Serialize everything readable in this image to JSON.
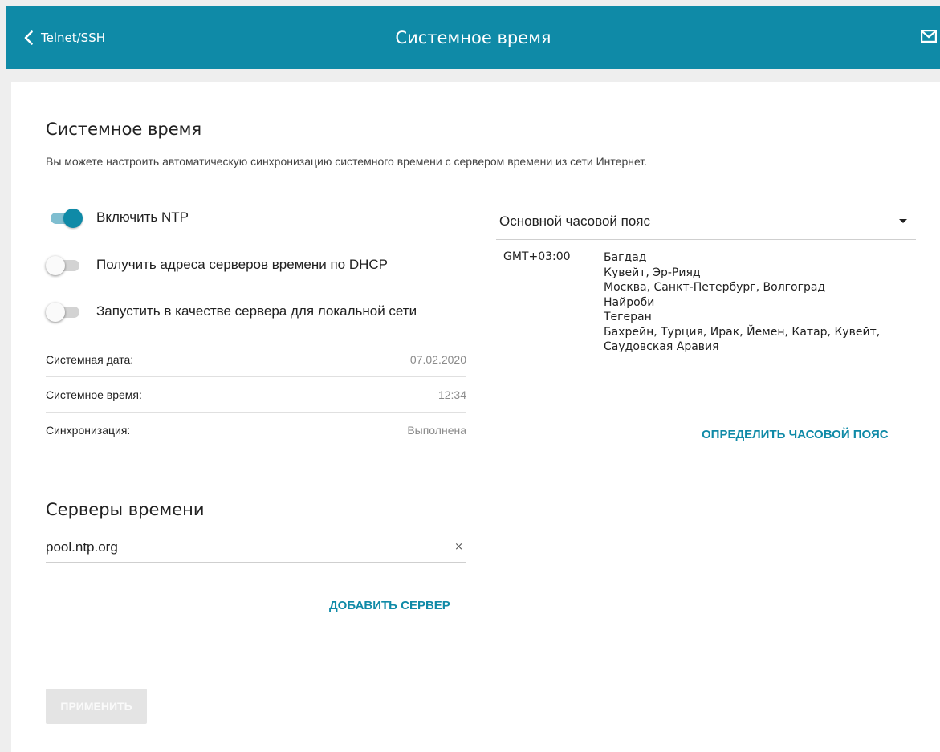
{
  "topbar": {
    "back_label": "Telnet/SSH",
    "title": "Системное время",
    "mail_icon": "mail-icon"
  },
  "page": {
    "title": "Системное время",
    "description": "Вы можете настроить автоматическую синхронизацию системного времени с сервером времени из сети Интернет."
  },
  "toggles": [
    {
      "label": "Включить NTP",
      "on": true
    },
    {
      "label": "Получить адреса серверов времени по DHCP",
      "on": false
    },
    {
      "label": "Запустить в качестве сервера для локальной сети",
      "on": false
    }
  ],
  "info": [
    {
      "label": "Системная дата:",
      "value": "07.02.2020"
    },
    {
      "label": "Системное время:",
      "value": "12:34"
    },
    {
      "label": "Синхронизация:",
      "value": "Выполнена"
    }
  ],
  "timezone": {
    "selected": "Основной часовой пояс",
    "offset": "GMT+03:00",
    "cities": [
      "Багдад",
      "Кувейт, Эр-Рияд",
      "Москва, Санкт-Петербург, Волгоград",
      "Найроби",
      "Тегеран",
      "Бахрейн, Турция, Ирак, Йемен, Катар, Кувейт, Саудовская Аравия"
    ],
    "detect_label": "ОПРЕДЕЛИТЬ ЧАСОВОЙ ПОЯС"
  },
  "servers": {
    "title": "Серверы времени",
    "items": [
      "pool.ntp.org"
    ],
    "clear_glyph": "×",
    "add_label": "ДОБАВИТЬ СЕРВЕР"
  },
  "apply_label": "ПРИМЕНИТЬ",
  "colors": {
    "accent": "#0f8aa7",
    "background": "#eeeeee"
  }
}
